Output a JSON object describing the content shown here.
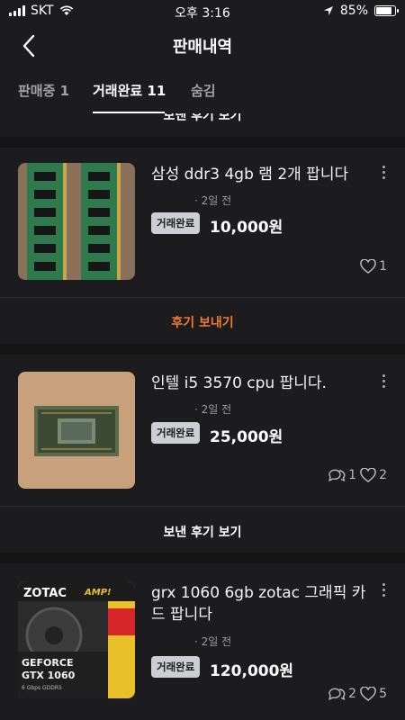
{
  "status": {
    "carrier": "SKT",
    "time": "오후 3:16",
    "battery": "85%",
    "battery_level": 0.85
  },
  "header": {
    "title": "판매내역",
    "back_icon": "chevron-left-icon"
  },
  "tabs": [
    {
      "label": "판매중 1",
      "active": false
    },
    {
      "label": "거래완료 11",
      "active": true
    },
    {
      "label": "숨김",
      "active": false
    }
  ],
  "cut_action": "보낸 후기 보기",
  "items": [
    {
      "title": "삼성 ddr3 4gb 램 2개 팝니다",
      "time": "· 2일 전",
      "badge": "거래완료",
      "price": "10,000원",
      "likes": "1",
      "action": "후기 보내기",
      "action_color": "#f07a35"
    },
    {
      "title": "인텔 i5 3570 cpu 팝니다.",
      "time": "· 2일 전",
      "badge": "거래완료",
      "price": "25,000원",
      "chats": "1",
      "likes": "2",
      "action": "보낸 후기 보기",
      "action_color": "#ffffff"
    },
    {
      "title": "grx 1060 6gb zotac 그래픽 카드 팝니다",
      "time": "· 2일 전",
      "badge": "거래완료",
      "price": "120,000원",
      "chats": "2",
      "likes": "5",
      "image_text": {
        "brand": "ZOTAC",
        "amp": "AMP!",
        "line1": "GEFORCE",
        "line2": "GTX 1060",
        "line3": "6 Gbps GDDR5"
      }
    }
  ]
}
